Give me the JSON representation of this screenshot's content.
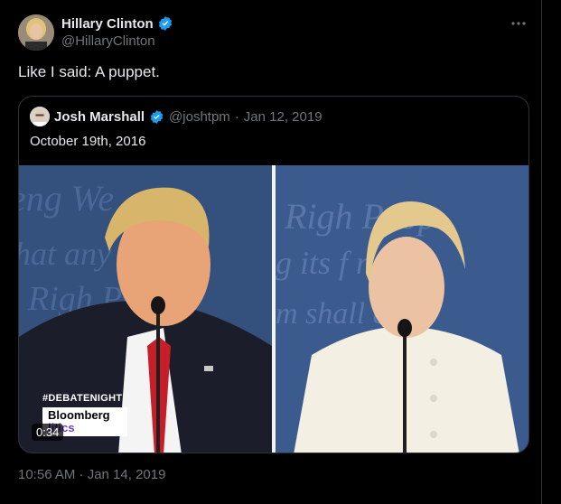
{
  "tweet": {
    "author_name": "Hillary Clinton",
    "author_handle": "@HillaryClinton",
    "text": "Like I said: A puppet.",
    "more_icon": "more-horizontal-icon",
    "timestamp": "10:56 AM · Jan 14, 2019"
  },
  "quote": {
    "author_name": "Josh Marshall",
    "author_handle": "@joshtpm",
    "separator": "·",
    "date": "Jan 12, 2019",
    "text": "October 19th, 2016",
    "media": {
      "hashtag": "#DEBATENIGHT",
      "brand_line1": "Bloomberg",
      "brand_line2": "litics",
      "duration": "0:34"
    }
  },
  "colors": {
    "background": "#000000",
    "verified": "#1d9bf0",
    "secondary_text": "#71767b",
    "border": "#2f3336"
  }
}
